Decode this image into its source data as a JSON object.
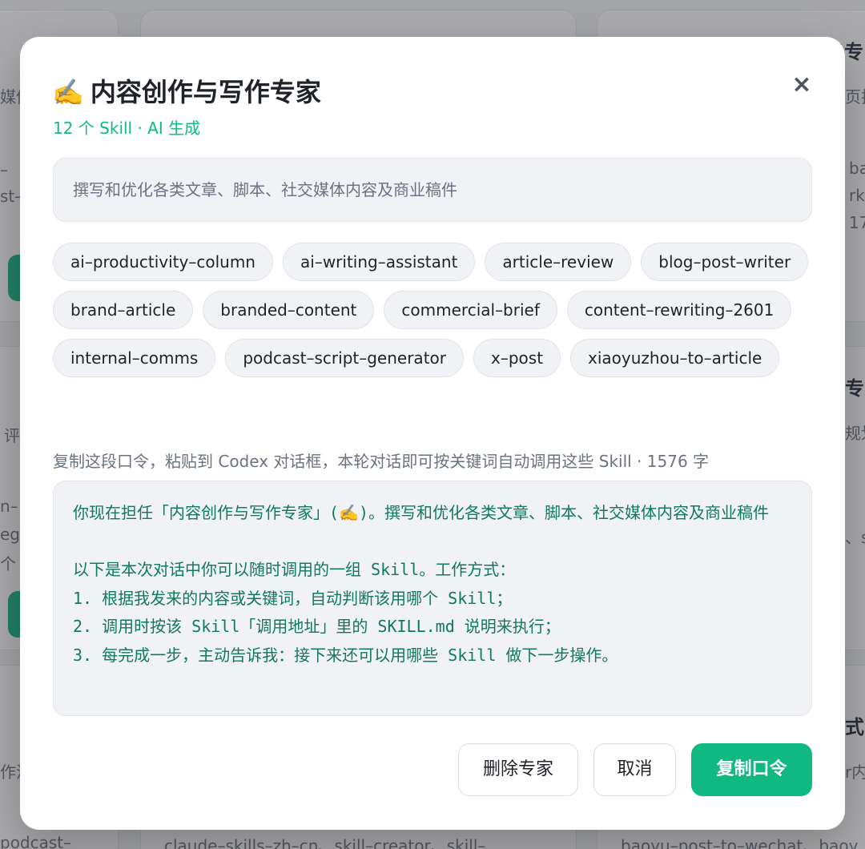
{
  "background": {
    "fragments": {
      "top_left_1": "媒体",
      "top_left_2": "–",
      "top_left_3": "st–",
      "mid_left_1": "评",
      "mid_left_2": "n–",
      "mid_left_3": "egy",
      "mid_left_4": "个",
      "bottom_left_1": "作流",
      "bottom_left_2": "podcast–",
      "bottom_mid": "claude–skills–zh–cn、skill–creator、skill–",
      "top_right_1": "换专",
      "top_right_2": "页排",
      "top_right_3": "ba",
      "top_right_4": "rkd",
      "top_right_5": "17",
      "mid_right_1": "专家",
      "mid_right_2": "规划",
      "mid_right_3": "、s",
      "bottom_right_1": "式专",
      "bottom_right_2": "r内",
      "bottom_right_3": "baoyu–post–to–wechat、baoy"
    }
  },
  "modal": {
    "emoji": "✍️",
    "title": "内容创作与写作专家",
    "subtitle": "12 个 Skill · AI 生成",
    "close_icon": "×",
    "description": "撰写和优化各类文章、脚本、社交媒体内容及商业稿件",
    "skills": [
      "ai–productivity–column",
      "ai–writing–assistant",
      "article–review",
      "blog–post–writer",
      "brand–article",
      "branded–content",
      "commercial–brief",
      "content–rewriting–2601",
      "internal–comms",
      "podcast–script–generator",
      "x–post",
      "xiaoyuzhou–to–article"
    ],
    "hint": "复制这段口令，粘贴到 Codex 对话框，本轮对话即可按关键词自动调用这些 Skill · 1576 字",
    "prompt_text": "你现在担任「内容创作与写作专家」(✍️)。撰写和优化各类文章、脚本、社交媒体内容及商业稿件\n\n以下是本次对话中你可以随时调用的一组 Skill。工作方式：\n1. 根据我发来的内容或关键词，自动判断该用哪个 Skill；\n2. 调用时按该 Skill「调用地址」里的 SKILL.md 说明来执行；\n3. 每完成一步，主动告诉我：接下来还可以用哪些 Skill 做下一步操作。",
    "buttons": {
      "delete": "删除专家",
      "cancel": "取消",
      "copy": "复制口令"
    }
  },
  "colors": {
    "accent": "#10b981",
    "prompt_text": "#0f7a5c"
  }
}
